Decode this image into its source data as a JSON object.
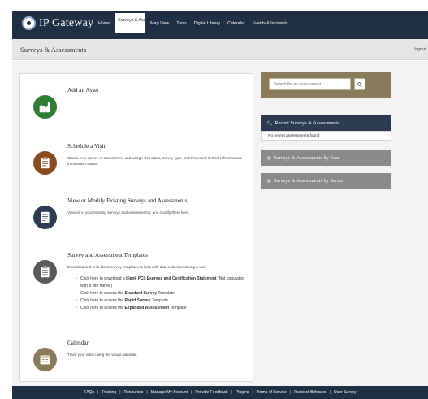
{
  "app": {
    "logo_text": "IP Gateway"
  },
  "nav": {
    "items": [
      {
        "label": "Home",
        "active": false
      },
      {
        "label": "Surveys & Assessments",
        "active": true
      },
      {
        "label": "Map View",
        "active": false
      },
      {
        "label": "Tools",
        "active": false
      },
      {
        "label": "Digital Library",
        "active": false
      },
      {
        "label": "Calendar",
        "active": false
      },
      {
        "label": "Events & Incidents",
        "active": false
      }
    ]
  },
  "header": {
    "title": "Surveys & Assessments",
    "logout": "logout"
  },
  "cards": [
    {
      "title": "Add an Asset",
      "description": "",
      "icon": "factory-icon",
      "color": "#2e7d32"
    },
    {
      "title": "Schedule a Visit",
      "description": "Start a new survey or assessment and assign visit dates, survey type, and Protected Critical Infrastructure Information status.",
      "icon": "clipboard-icon",
      "color": "#8a4a1c"
    },
    {
      "title": "View or Modify Existing Surveys and Assessments",
      "description": "View all of your existing surveys and assessments, and modify them here.",
      "icon": "document-icon",
      "color": "#2a3b52"
    },
    {
      "title": "Survey and Assessment Templates",
      "description": "Download and print blank survey templates to help with data collection during a visit.",
      "icon": "template-icon",
      "color": "#5a5a5a"
    },
    {
      "title": "Calendar",
      "description": "Track your visits using the visual calendar.",
      "icon": "calendar-icon",
      "color": "#8a7c5a"
    }
  ],
  "templates": [
    {
      "prefix": "Click here to download a ",
      "bold": "blank PCII Express and Certification Statement",
      "suffix": " (Not populated with a site name.)"
    },
    {
      "prefix": "Click here to access the ",
      "bold": "Standard Survey",
      "suffix": " Template"
    },
    {
      "prefix": "Click here to access the ",
      "bold": "Rapid Survey",
      "suffix": " Template"
    },
    {
      "prefix": "Click here to access the ",
      "bold": "Expanded Assessment",
      "suffix": " Template"
    }
  ],
  "search": {
    "placeholder": "Search for an assessment",
    "icon": "search-icon"
  },
  "sidebar": {
    "recent": {
      "title": "Recent Surveys & Assessments",
      "empty": "No recent assessments found"
    },
    "by_year": {
      "title": "Surveys & Assessments by Year"
    },
    "by_sector": {
      "title": "Surveys & Assessments by Sector"
    }
  },
  "footer": {
    "links": [
      "FAQs",
      "Training",
      "Resources",
      "Manage My Account",
      "Provide Feedback",
      "Plugins",
      "Terms of Service",
      "Rules of Behavior",
      "User Survey"
    ]
  },
  "colors": {
    "navy": "#1f2f44",
    "gold": "#8a7c5a",
    "grey": "#8a8a8a"
  }
}
